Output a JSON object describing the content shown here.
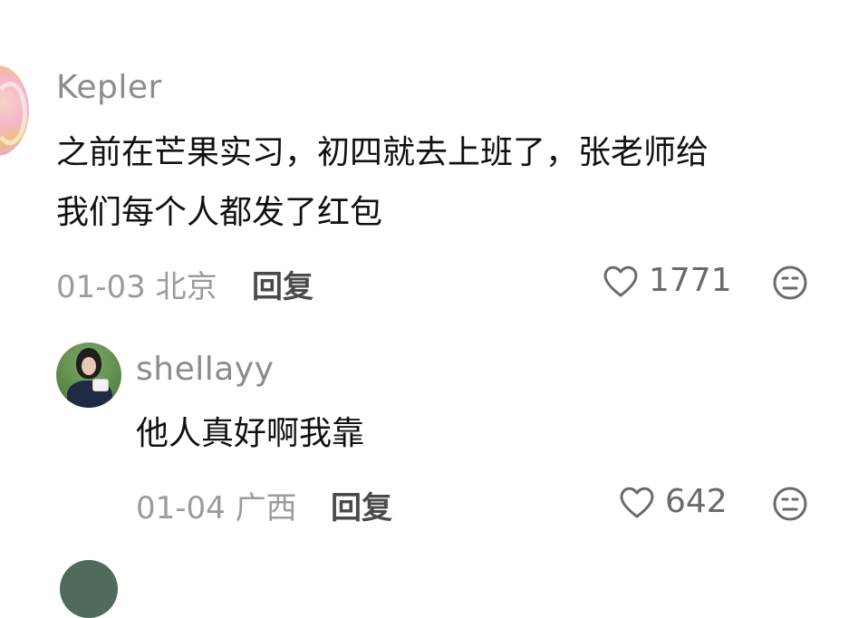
{
  "comments": [
    {
      "username": "Kepler",
      "text": "之前在芒果实习，初四就去上班了，张老师给\n我们每个人都发了红包",
      "date_location": "01-03 北京",
      "reply_label": "回复",
      "likes": "1771",
      "avatar_icon": "avatar-image",
      "like_icon": "heart-outline-icon",
      "dislike_icon": "meh-face-icon"
    },
    {
      "username": "shellayy",
      "text": "他人真好啊我靠",
      "date_location": "01-04 广西",
      "reply_label": "回复",
      "likes": "642",
      "avatar_icon": "avatar-image",
      "like_icon": "heart-outline-icon",
      "dislike_icon": "meh-face-icon"
    }
  ],
  "colors": {
    "username": "#8c8c8c",
    "meta": "#9b9b9b",
    "text": "#111111",
    "icon": "#666666"
  }
}
